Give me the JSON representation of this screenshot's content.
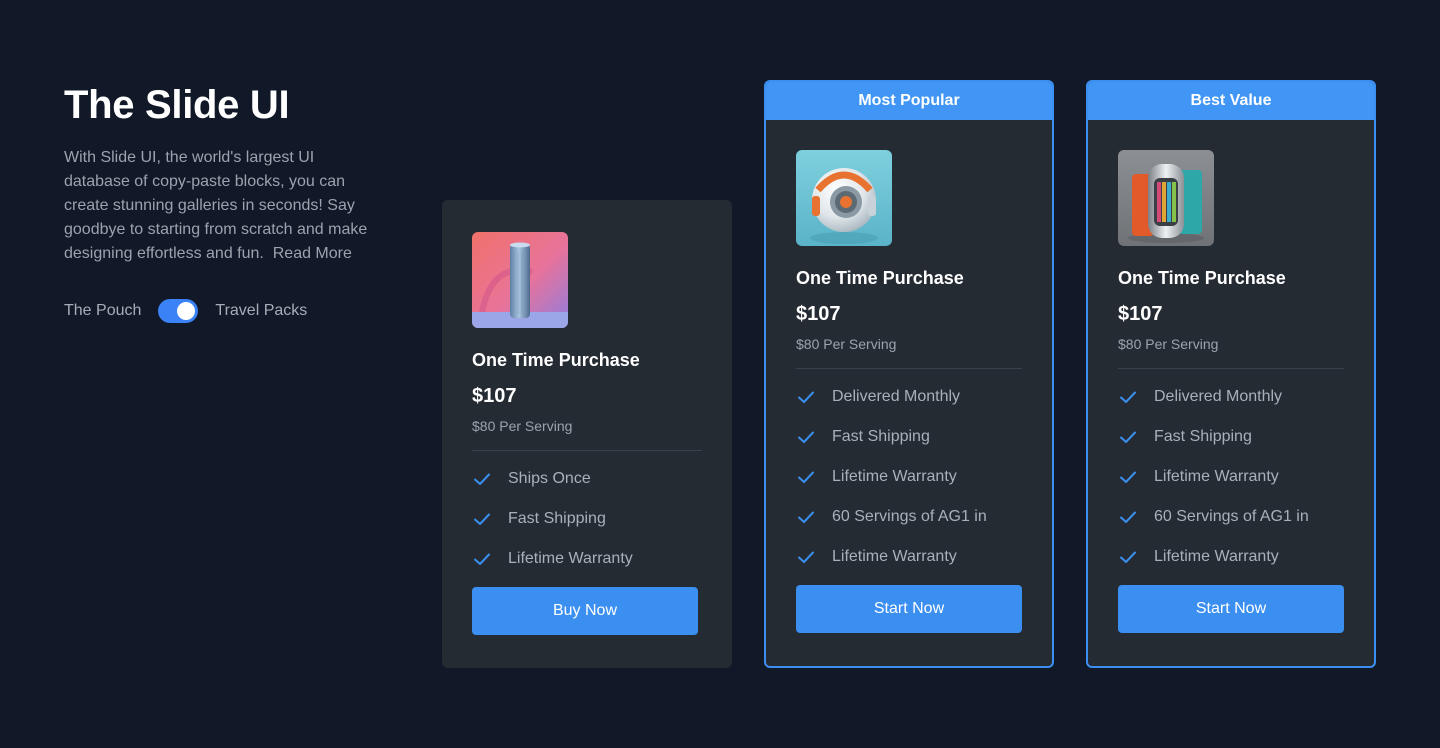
{
  "intro": {
    "title": "The Slide UI",
    "description": "With Slide UI, the world's largest UI database of copy-paste blocks, you can create stunning galleries in seconds! Say goodbye to starting from scratch and make designing effortless and fun.",
    "read_more": "Read More",
    "toggle": {
      "left_label": "The Pouch",
      "right_label": "Travel Packs",
      "state": "on"
    }
  },
  "colors": {
    "background": "#111827",
    "card": "#252b33",
    "accent": "#3b8ff0"
  },
  "cards": [
    {
      "banner": "",
      "image": "tall-cylinder-bottle-image",
      "title": "One Time Purchase",
      "price": "$107",
      "serving": "$80 Per Serving",
      "features": [
        "Ships Once",
        "Fast Shipping",
        "Lifetime Warranty"
      ],
      "button": "Buy Now"
    },
    {
      "banner": "Most Popular",
      "image": "round-device-image",
      "title": "One Time Purchase",
      "price": "$107",
      "serving": "$80 Per Serving",
      "features": [
        "Delivered Monthly",
        "Fast Shipping",
        "Lifetime Warranty",
        "60 Servings of AG1 in",
        "Lifetime Warranty"
      ],
      "button": "Start Now"
    },
    {
      "banner": "Best Value",
      "image": "travel-pack-image",
      "title": "One Time Purchase",
      "price": "$107",
      "serving": "$80 Per Serving",
      "features": [
        "Delivered Monthly",
        "Fast Shipping",
        "Lifetime Warranty",
        "60 Servings of AG1 in",
        "Lifetime Warranty"
      ],
      "button": "Start Now"
    }
  ]
}
